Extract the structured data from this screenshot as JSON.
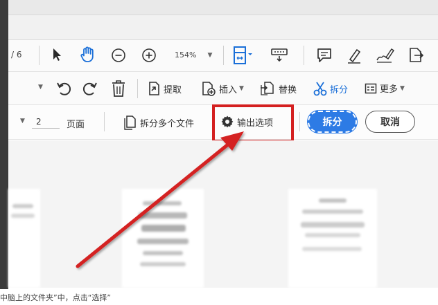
{
  "toolbar_top": {
    "page_counter": "/ 6",
    "zoom_value": "154%",
    "icons": [
      "select-arrow-icon",
      "hand-icon",
      "zoom-out-icon",
      "zoom-in-icon",
      "fit-page-icon",
      "keyboard-icon",
      "comment-icon",
      "highlight-pen-icon",
      "sign-icon",
      "share-icon"
    ]
  },
  "toolbar_organize": {
    "extract_label": "提取",
    "insert_label": "插入",
    "replace_label": "替换",
    "split_label": "拆分",
    "more_label": "更多"
  },
  "split_bar": {
    "page_count_value": "2",
    "pages_label": "页面",
    "split_multiple_label": "拆分多个文件",
    "output_options_label": "输出选项",
    "split_button_label": "拆分",
    "cancel_button_label": "取消"
  },
  "caption": "中脑上的文件夹”中，点击“选择”",
  "colors": {
    "accent_blue": "#2d7be5",
    "highlight_red": "#d42020"
  }
}
